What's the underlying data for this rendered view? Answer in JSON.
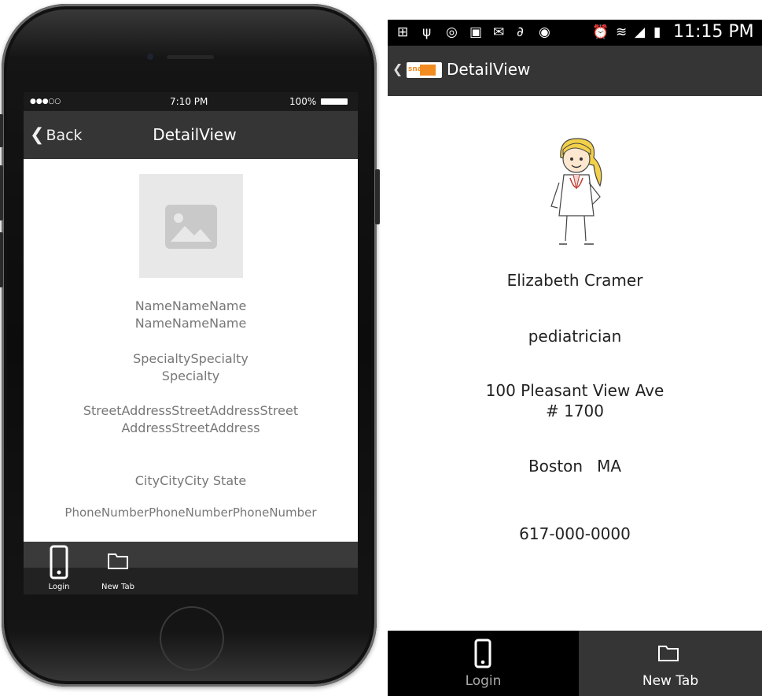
{
  "ios": {
    "status": {
      "carrier_dots": "●●●○○",
      "time": "7:10 PM",
      "battery": "100%"
    },
    "nav": {
      "back_label": "Back",
      "title": "DetailView"
    },
    "fields": {
      "name": "NameNameName NameNameName",
      "specialty": "SpecialtySpecialty Specialty",
      "address": "StreetAddressStreetAddressStreetAddressStreetAddress",
      "city_state": "CityCityCity State",
      "phone": "PhoneNumberPhoneNumberPhoneNumber"
    },
    "tabs": [
      {
        "label": "Login",
        "icon": "phone-icon"
      },
      {
        "label": "New Tab",
        "icon": "folder-icon"
      }
    ]
  },
  "android": {
    "status": {
      "time": "11:15 PM"
    },
    "actionbar": {
      "app_logo_text": "snapp",
      "title": "DetailView"
    },
    "doctor": {
      "name": "Elizabeth Cramer",
      "specialty": "pediatrician",
      "address_line1": "100 Pleasant View Ave",
      "address_line2": "# 1700",
      "city": "Boston",
      "state": "MA",
      "phone": "617-000-0000"
    },
    "tabs": [
      {
        "label": "Login",
        "icon": "phone-icon"
      },
      {
        "label": "New Tab",
        "icon": "folder-icon"
      }
    ]
  },
  "colors": {
    "nav_bar": "#353535",
    "tab_bar": "#000000",
    "accent": "#f28b20"
  }
}
